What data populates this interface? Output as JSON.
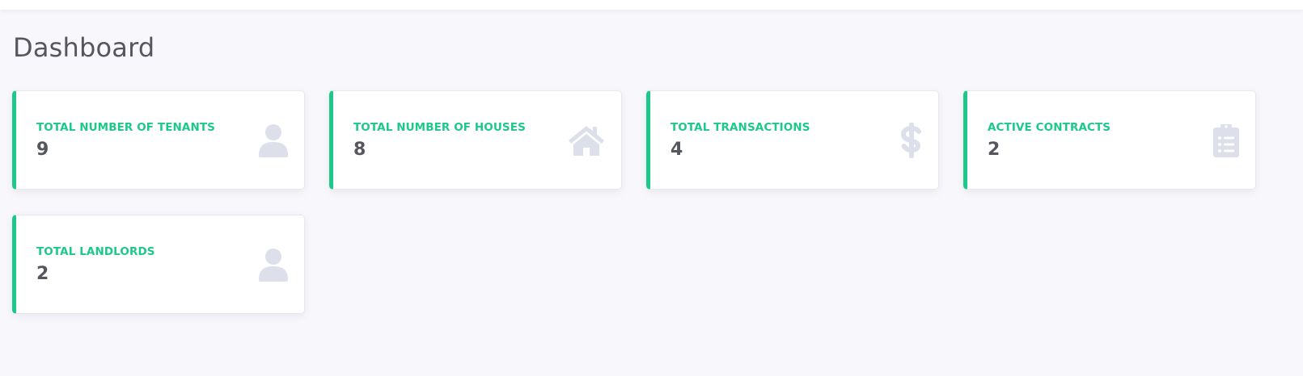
{
  "page": {
    "title": "Dashboard"
  },
  "colors": {
    "accent": "#1cc88a",
    "icon": "#dddfeb",
    "text": "#55565e",
    "background": "#f8f8fc"
  },
  "cards": [
    {
      "label": "TOTAL NUMBER OF TENANTS",
      "value": "9",
      "icon": "user-icon"
    },
    {
      "label": "TOTAL NUMBER OF HOUSES",
      "value": "8",
      "icon": "house-icon"
    },
    {
      "label": "TOTAL TRANSACTIONS",
      "value": "4",
      "icon": "dollar-icon"
    },
    {
      "label": "ACTIVE CONTRACTS",
      "value": "2",
      "icon": "clipboard-list-icon"
    },
    {
      "label": "TOTAL LANDLORDS",
      "value": "2",
      "icon": "user-icon"
    }
  ]
}
